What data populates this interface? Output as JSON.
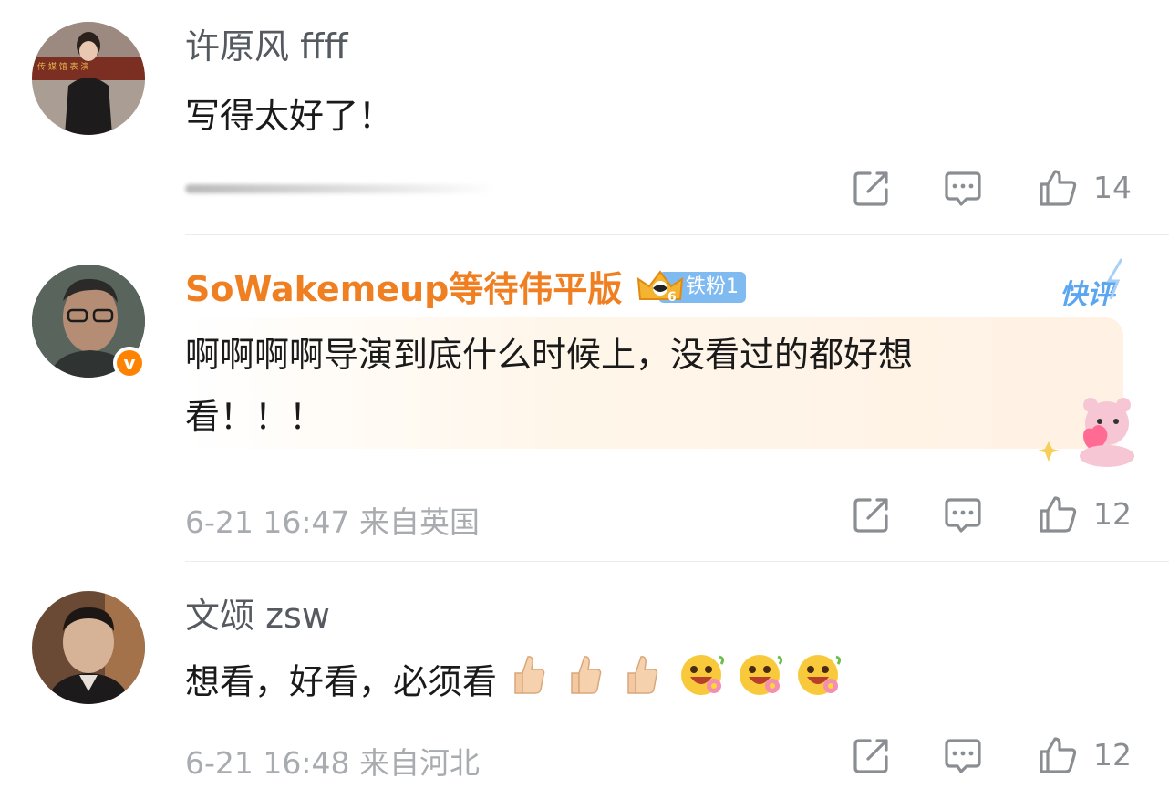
{
  "comments": [
    {
      "username": "许原风 ffff",
      "text": "写得太好了！",
      "meta": "",
      "likes": "14"
    },
    {
      "username": "SoWakemeup等待伟平版",
      "fan_badge": "铁粉1",
      "fan_level": "6",
      "kuaiping": "快评",
      "verified_mark": "v",
      "text_line1": "啊啊啊啊导演到底什么时候上，没看过的都好想",
      "text_line2": "看！！！",
      "meta": "6-21 16:47  来自英国",
      "likes": "12"
    },
    {
      "username": "文颂 zsw",
      "text": "想看，好看，必须看",
      "emojis": [
        "thumbs-up-icon",
        "thumbs-up-icon",
        "thumbs-up-icon",
        "flower-smile-emoji",
        "flower-smile-emoji",
        "flower-smile-emoji"
      ],
      "meta": "6-21 16:48  来自河北",
      "likes": "12"
    }
  ],
  "colors": {
    "orange_name": "#f07f22",
    "meta_gray": "#a8acb0",
    "icon_gray": "#8a8e93",
    "fan_badge_blue": "#7fbaf0",
    "kuaiping_blue": "#5aa6f0"
  }
}
